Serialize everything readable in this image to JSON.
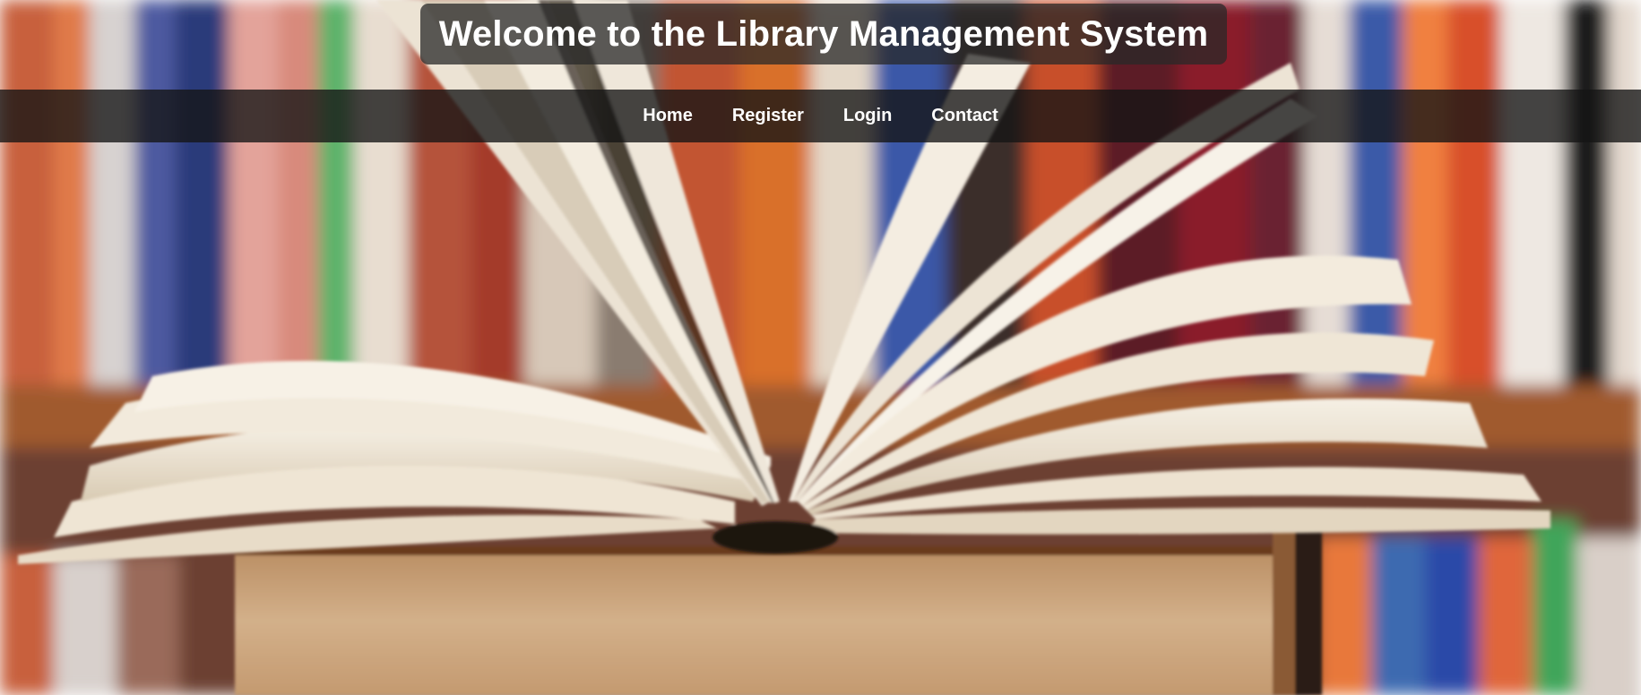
{
  "header": {
    "title": "Welcome to the Library Management System"
  },
  "nav": {
    "items": [
      {
        "label": "Home"
      },
      {
        "label": "Register"
      },
      {
        "label": "Login"
      },
      {
        "label": "Contact"
      }
    ]
  },
  "colors": {
    "title_box_bg": "#282828",
    "navbar_bg": "#141414",
    "text": "#ffffff"
  },
  "background": {
    "image": "bookshelf-open-book-photo"
  }
}
